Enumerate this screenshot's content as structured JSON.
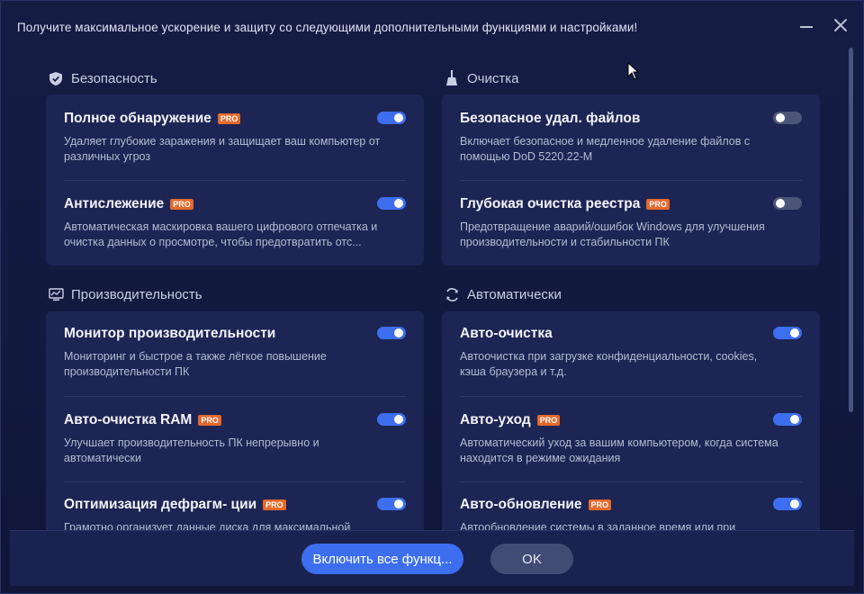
{
  "window": {
    "title": "Получите максимальное ускорение и защиту со следующими дополнительными функциями и настройками!"
  },
  "colors": {
    "accent": "#3d6ef0",
    "pro_badge": "#e6692c",
    "card_bg": "#1c2553",
    "window_bg": "#151c44"
  },
  "sections": {
    "security": {
      "title": "Безопасность",
      "icon": "shield-icon",
      "items": [
        {
          "title": "Полное обнаружение",
          "pro": "PRO",
          "desc": "Удаляет глубокие заражения и защищает ваш компьютер от различных угроз",
          "enabled": true
        },
        {
          "title": "Антислежение",
          "pro": "PRO",
          "desc": "Автоматическая маскировка вашего цифрового отпечатка и очистка данных о просмотре, чтобы предотвратить отс...",
          "enabled": true
        }
      ]
    },
    "cleaning": {
      "title": "Очистка",
      "icon": "broom-icon",
      "items": [
        {
          "title": "Безопасное удал. файлов",
          "pro": "",
          "desc": "Включает безопасное и медленное удаление файлов с помощью DoD 5220.22-M",
          "enabled": false
        },
        {
          "title": "Глубокая очистка реестра",
          "pro": "PRO",
          "desc": "Предотвращение аварий/ошибок Windows для улучшения производительности и стабильности ПК",
          "enabled": false
        }
      ]
    },
    "performance": {
      "title": "Производительность",
      "icon": "monitor-chart-icon",
      "items": [
        {
          "title": "Монитор производительности",
          "pro": "",
          "desc": "Мониторинг и быстрое а также лёгкое повышение производительности ПК",
          "enabled": true
        },
        {
          "title": "Авто-очистка RAM",
          "pro": "PRO",
          "desc": "Улучшает производительность ПК непрерывно и автоматически",
          "enabled": true
        },
        {
          "title": "Оптимизация дефрагм- ции",
          "pro": "PRO",
          "desc": "Грамотно организует данные диска для максимальной",
          "enabled": true
        }
      ]
    },
    "automatic": {
      "title": "Автоматически",
      "icon": "refresh-icon",
      "items": [
        {
          "title": "Авто-очистка",
          "pro": "",
          "desc": "Автоочистка при загрузке конфиденциальности, cookies, кэша браузера и т.д.",
          "enabled": true
        },
        {
          "title": "Авто-уход",
          "pro": "PRO",
          "desc": "Автоматический уход за вашим компьютером, когда система находится в режиме ожидания",
          "enabled": true
        },
        {
          "title": "Авто-обновление",
          "pro": "PRO",
          "desc": "Автообновление системы в заданное время или при",
          "enabled": true
        }
      ]
    }
  },
  "footer": {
    "enable_all_label": "Включить все функц...",
    "ok_label": "OK"
  }
}
